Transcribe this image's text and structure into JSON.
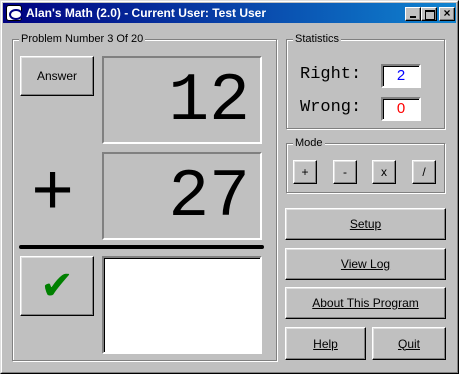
{
  "window": {
    "title": "Alan's Math (2.0) - Current User: Test User",
    "minimize_label": "_",
    "maximize_label": "□",
    "close_label": "×"
  },
  "problem": {
    "group_label": "Problem Number 3 Of 20",
    "answer_button": "Answer",
    "top_number": "12",
    "operator": "+",
    "bottom_number": "27",
    "answer_value": "",
    "check_icon": "check-icon",
    "check_color": "#008000"
  },
  "statistics": {
    "group_label": "Statistics",
    "right_label": "Right:",
    "right_value": "2",
    "right_color": "#0000ff",
    "wrong_label": "Wrong:",
    "wrong_value": "0",
    "wrong_color": "#ff0000"
  },
  "mode": {
    "group_label": "Mode",
    "buttons": [
      "+",
      "-",
      "x",
      "/"
    ]
  },
  "actions": {
    "setup": "Setup",
    "view_log": "View Log",
    "about": "About This Program",
    "help": "Help",
    "quit": "Quit"
  },
  "colors": {
    "title_gradient_start": "#000080",
    "title_gradient_end": "#1084d0",
    "face": "#c0c0c0"
  }
}
